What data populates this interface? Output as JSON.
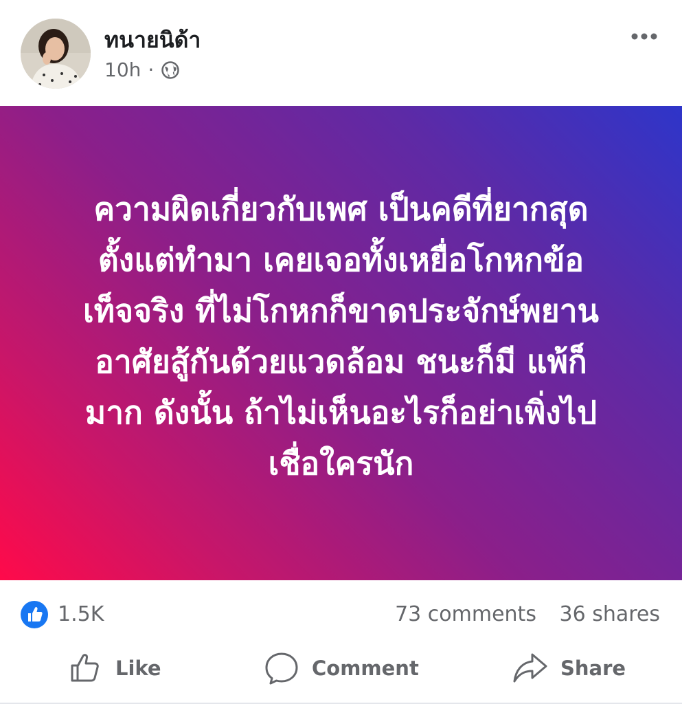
{
  "post": {
    "author": "ทนายนิด้า",
    "time": "10h",
    "separator": "·",
    "privacy_icon": "globe-icon",
    "more_icon": "more-horizontal-icon",
    "text_lines": [
      "ความผิดเกี่ยวกับเพศ เป็นคดีที่ยากสุด",
      "ตั้งแต่ทำมา เคยเจอทั้งเหยื่อโกหกข้อ",
      "เท็จจริง ที่ไม่โกหกก็ขาดประจักษ์พยาน",
      "อาศัยสู้กันด้วยแวดล้อม ชนะก็มี แพ้ก็",
      "มาก ดังนั้น ถ้าไม่เห็นอะไรก็อย่าเพิ่งไป",
      "เชื่อใครนัก"
    ],
    "background_colors": [
      "#2e35c9",
      "#8b1f8a",
      "#ff0a4a"
    ]
  },
  "stats": {
    "reaction_icon": "like-reaction-icon",
    "reactions": "1.5K",
    "comments": "73 comments",
    "shares": "36 shares"
  },
  "actions": {
    "like_label": "Like",
    "comment_label": "Comment",
    "share_label": "Share"
  }
}
